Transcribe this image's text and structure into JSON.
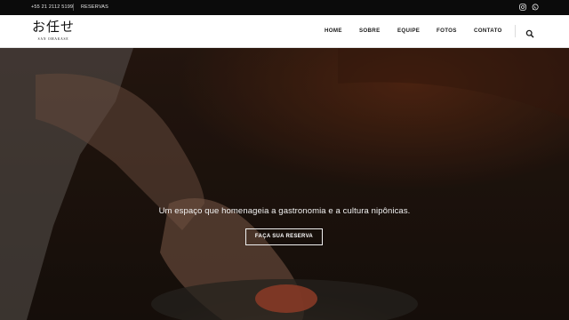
{
  "topbar": {
    "phone": "+55 21 2112 5199",
    "reservas_link": "RESERVAS",
    "social": [
      "instagram-icon",
      "whatsapp-icon"
    ]
  },
  "header": {
    "logo": {
      "japanese": "お任せ",
      "subtitle": "SAN OMAKASE"
    },
    "nav": [
      {
        "label": "HOME"
      },
      {
        "label": "SOBRE"
      },
      {
        "label": "EQUIPE"
      },
      {
        "label": "FOTOS"
      },
      {
        "label": "CONTATO"
      }
    ],
    "search_icon": "search-icon"
  },
  "hero": {
    "tagline": "Um espaço que homenageia a gastronomia e a cultura nipônicas.",
    "cta_label": "FAÇA SUA RESERVA"
  },
  "colors": {
    "topbar_bg": "#0b0b0b",
    "header_bg": "#ffffff",
    "hero_tone": "#23160f",
    "text_light": "#f2f2f2"
  }
}
